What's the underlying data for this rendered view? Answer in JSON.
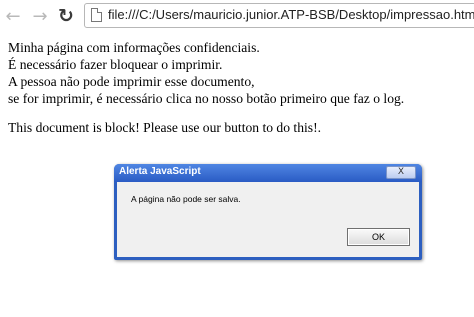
{
  "browser": {
    "back_icon": "arrow-left-icon",
    "forward_icon": "arrow-right-icon",
    "reload_icon": "reload-icon",
    "url": "file:///C:/Users/mauricio.junior.ATP-BSB/Desktop/impressao.html"
  },
  "page": {
    "paragraph1": [
      "Minha página com informações confidenciais.",
      "É necessário fazer bloquear o imprimir.",
      "A pessoa não pode imprimir esse documento,",
      "se for imprimir, é necessário clica no nosso botão primeiro que faz o log."
    ],
    "paragraph2": "This document is block! Please use our button to do this!."
  },
  "dialog": {
    "title": "Alerta JavaScript",
    "close_label": "X",
    "message": "A página não pode ser salva.",
    "ok_label": "OK",
    "colors": {
      "frame": "#2d5fc0",
      "body": "#f0f0f0"
    }
  }
}
